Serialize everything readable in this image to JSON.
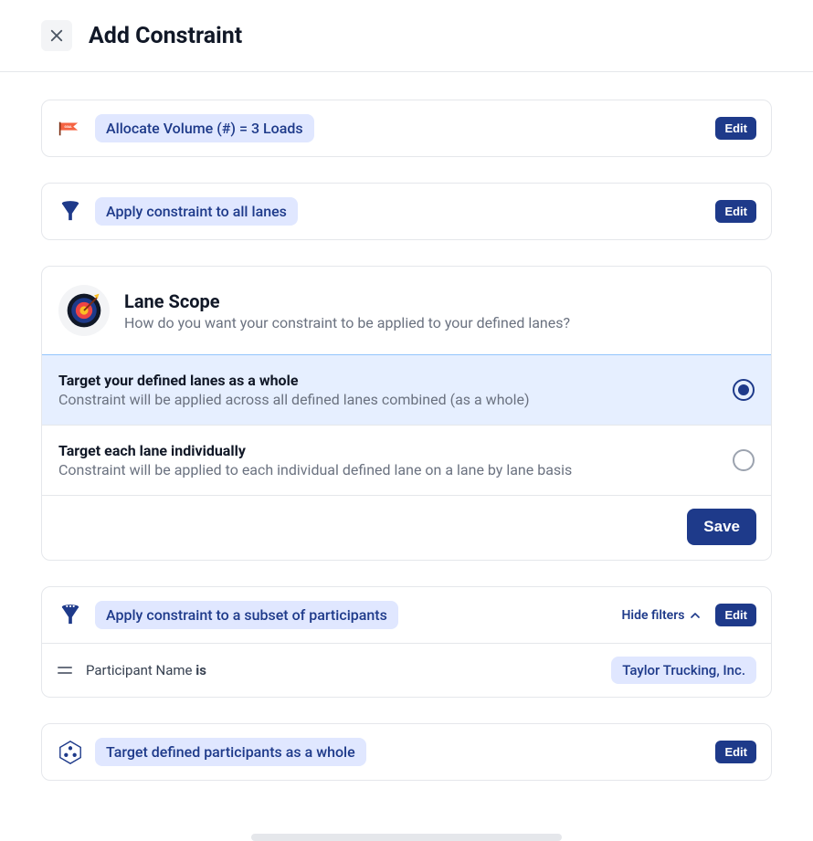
{
  "header": {
    "title": "Add Constraint"
  },
  "summary1": {
    "badge": "Allocate Volume (#) = 3 Loads",
    "edit": "Edit"
  },
  "summary2": {
    "badge": "Apply constraint to all lanes",
    "edit": "Edit"
  },
  "scope": {
    "title": "Lane Scope",
    "subtitle": "How do you want your constraint to be applied to your defined lanes?",
    "options": [
      {
        "title": "Target your defined lanes as a whole",
        "sub": "Constraint will be applied across all defined lanes combined (as a whole)",
        "selected": true
      },
      {
        "title": "Target each lane individually",
        "sub": "Constraint will be applied to each individual defined lane on a lane by lane basis",
        "selected": false
      }
    ],
    "save": "Save"
  },
  "participants": {
    "badge": "Apply constraint to a subset of participants",
    "toggle": "Hide filters",
    "edit": "Edit",
    "filter": {
      "field": "Participant Name",
      "operator": "is",
      "value": "Taylor Trucking, Inc."
    }
  },
  "participant_scope": {
    "badge": "Target defined participants as a whole",
    "edit": "Edit"
  },
  "colors": {
    "primary": "#1e3a8a",
    "badge_bg": "#e0e7ff",
    "selected_bg": "#e6efff"
  }
}
